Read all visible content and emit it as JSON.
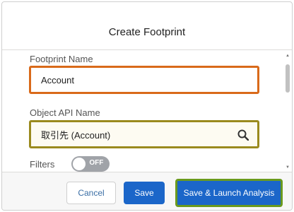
{
  "modal": {
    "title": "Create Footprint"
  },
  "form": {
    "footprint_name_label": "Footprint Name",
    "footprint_name_value": "Account",
    "object_api_label": "Object API Name",
    "object_api_value": "取引先 (Account)",
    "filters_label": "Filters",
    "filters_toggle_text": "OFF"
  },
  "footer": {
    "cancel_label": "Cancel",
    "save_label": "Save",
    "launch_label": "Save & Launch Analysis"
  },
  "colors": {
    "primary": "#1b66c9",
    "highlight_name": "#d96a1a",
    "highlight_api": "#9a8a1e",
    "highlight_launch": "#6a9a1e"
  }
}
